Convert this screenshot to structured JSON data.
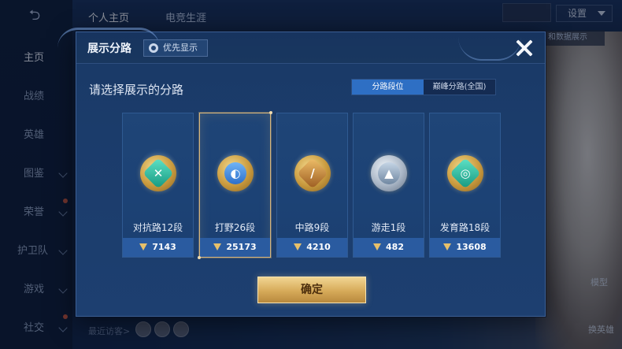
{
  "background": {
    "sidebar": {
      "items": [
        {
          "label": "主页",
          "active": true
        },
        {
          "label": "战绩"
        },
        {
          "label": "英雄"
        },
        {
          "label": "图鉴"
        },
        {
          "label": "荣誉"
        },
        {
          "label": "护卫队"
        },
        {
          "label": "游戏"
        },
        {
          "label": "社交"
        }
      ]
    },
    "tabs": [
      "个人主页",
      "电竞生涯"
    ],
    "settings_label": "设置",
    "right_chip_label": "和数据展示",
    "visitors_label": "最近访客>",
    "model_label": "模型",
    "change_hero_label": "换英雄"
  },
  "dialog": {
    "title": "展示分路",
    "priority_label": "优先显示",
    "prompt": "请选择展示的分路",
    "tabs": [
      {
        "label": "分路段位",
        "active": true
      },
      {
        "label": "巅峰分路(全国)",
        "active": false
      }
    ],
    "lanes": [
      {
        "label": "对抗路12段",
        "points": "7143",
        "icon": "clash-lane-medal-icon",
        "color": "green",
        "selected": false
      },
      {
        "label": "打野26段",
        "points": "25173",
        "icon": "jungle-medal-icon",
        "color": "blue",
        "selected": true
      },
      {
        "label": "中路9段",
        "points": "4210",
        "icon": "mid-lane-medal-icon",
        "color": "bronze",
        "selected": false
      },
      {
        "label": "游走1段",
        "points": "482",
        "icon": "roam-medal-icon",
        "color": "steel",
        "selected": false
      },
      {
        "label": "发育路18段",
        "points": "13608",
        "icon": "farm-lane-medal-icon",
        "color": "green",
        "selected": false
      }
    ],
    "confirm_label": "确定"
  },
  "colors": {
    "accent_gold": "#d6b57c",
    "tab_active": "#2e6fc4",
    "card_footer": "#2a5ba0",
    "dialog_bg": "#1b3c6b"
  }
}
